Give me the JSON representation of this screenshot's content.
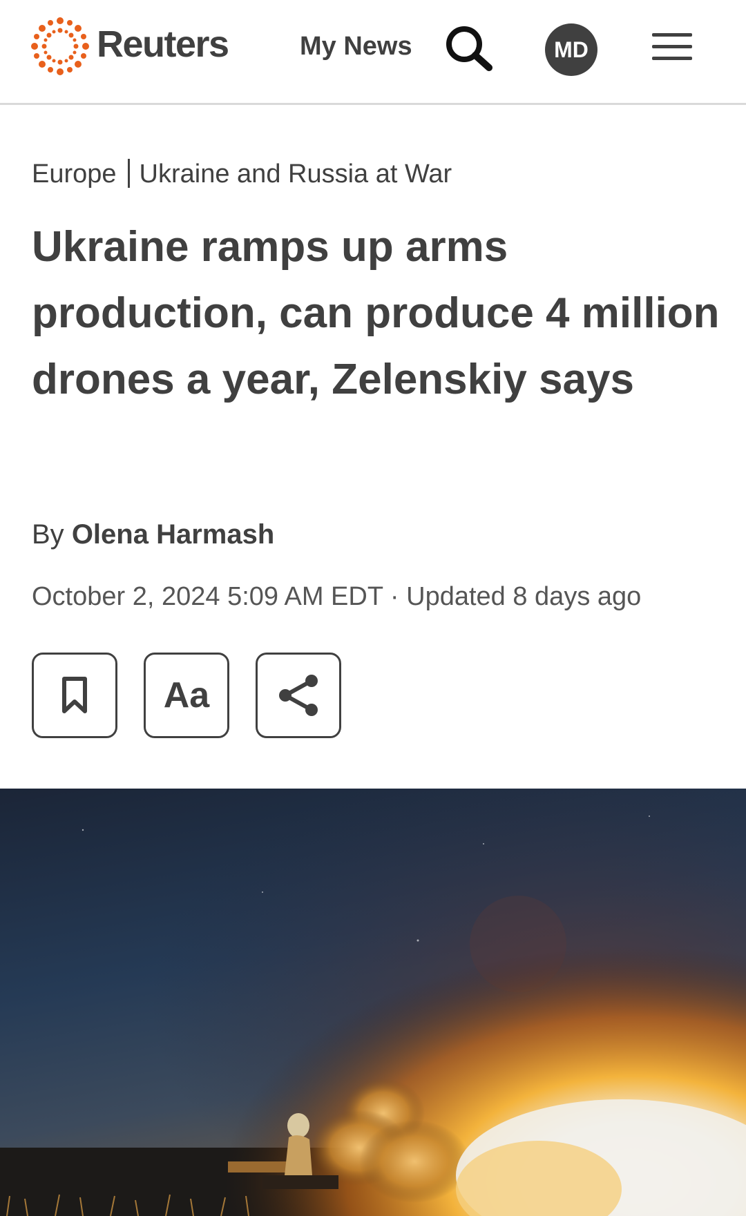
{
  "header": {
    "logo_text": "Reuters",
    "my_news_label": "My News",
    "avatar_initials": "MD",
    "brand_color": "#e8601c"
  },
  "breadcrumb": {
    "section": "Europe",
    "topic": "Ukraine and Russia at War"
  },
  "article": {
    "headline": "Ukraine ramps up arms production, can produce 4 million drones a year, Zelenskiy says",
    "byline_prefix": "By",
    "author": "Olena Harmash",
    "dateline": "October 2, 2024 5:09 AM EDT · Updated 8 days ago"
  },
  "actions": {
    "text_size_label": "Aa",
    "bookmark_icon": "bookmark-icon",
    "share_icon": "share-icon"
  },
  "hero_image": {
    "description_icon": "photo"
  }
}
